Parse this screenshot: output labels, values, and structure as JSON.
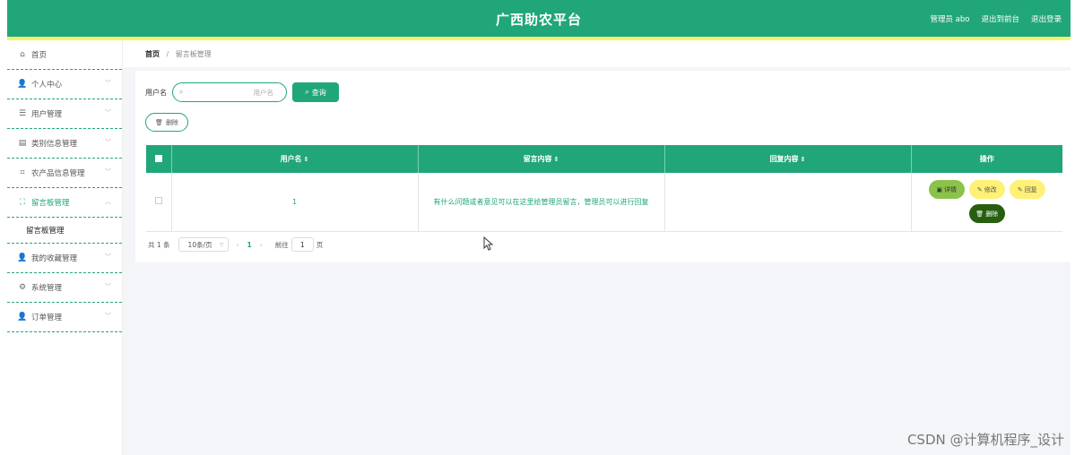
{
  "header": {
    "title": "广西助农平台",
    "links": [
      "管理员 abo",
      "退出到前台",
      "退出登录"
    ]
  },
  "sidebar": {
    "items": [
      {
        "label": "首页",
        "icon": "home-icon"
      },
      {
        "label": "个人中心",
        "icon": "user-icon"
      },
      {
        "label": "用户管理",
        "icon": "list-icon"
      },
      {
        "label": "类别信息管理",
        "icon": "clipboard-icon"
      },
      {
        "label": "农产品信息管理",
        "icon": "crop-icon"
      },
      {
        "label": "留言板管理",
        "icon": "fullscreen-icon"
      },
      {
        "label": "我的收藏管理",
        "icon": "user-icon"
      },
      {
        "label": "系统管理",
        "icon": "settings-icon"
      },
      {
        "label": "订单管理",
        "icon": "user-icon"
      }
    ],
    "submenu": "留言板管理"
  },
  "breadcrumb": {
    "home": "首页",
    "separator": "/",
    "current": "留言板管理"
  },
  "search": {
    "label": "用户名",
    "placeholder": "用户名",
    "button": "查询"
  },
  "toolbar": {
    "delete_label": "删除"
  },
  "table": {
    "columns": [
      "用户名",
      "留言内容",
      "回复内容",
      "操作"
    ],
    "rows": [
      {
        "username": "1",
        "message": "有什么问题或者意见可以在这里给管理员留言，管理员可以进行回复",
        "reply": "",
        "actions": [
          "详情",
          "修改",
          "回复",
          "删除"
        ]
      }
    ]
  },
  "pagination": {
    "total": "共 1 条",
    "page_size": "10条/页",
    "current_page": "1",
    "goto_label": "前往",
    "goto_value": "1",
    "page_unit": "页"
  },
  "watermark": "CSDN @计算机程序_设计",
  "colors": {
    "primary": "#21a67a",
    "accent_strip": "#f2f56c",
    "detail": "#8bc34a",
    "edit": "#fff176",
    "delete": "#275e10"
  }
}
